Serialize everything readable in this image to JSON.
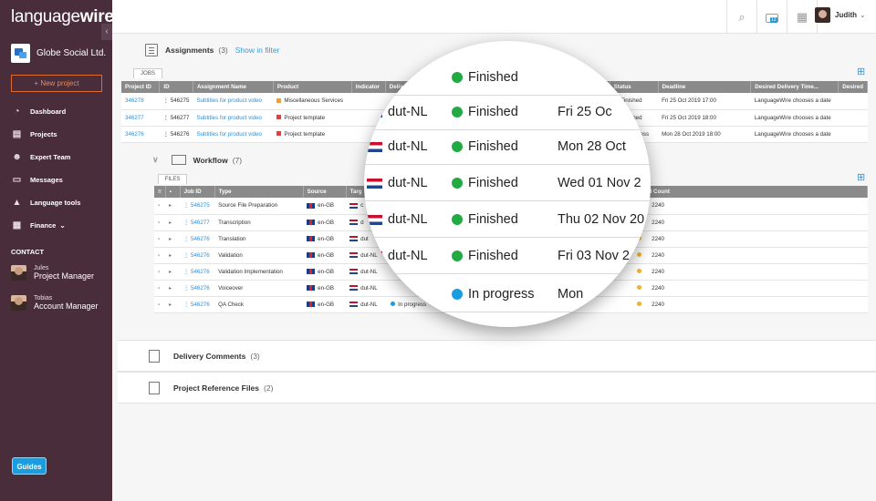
{
  "app": {
    "logo_a": "language",
    "logo_b": "wire"
  },
  "sidebar": {
    "company": "Globe Social Ltd.",
    "new_project": "+ New project",
    "items": [
      {
        "label": "Dashboard",
        "icon": "speedometer-icon"
      },
      {
        "label": "Projects",
        "icon": "folders-icon"
      },
      {
        "label": "Expert Team",
        "icon": "team-icon"
      },
      {
        "label": "Messages",
        "icon": "chat-icon"
      },
      {
        "label": "Language tools",
        "icon": "tools-icon"
      },
      {
        "label": "Finance",
        "icon": "finance-icon"
      }
    ],
    "contact_heading": "CONTACT",
    "contacts": [
      {
        "name": "Jules",
        "role": "Project Manager"
      },
      {
        "name": "Tobias",
        "role": "Account Manager"
      }
    ],
    "guides": "Guides"
  },
  "topbar": {
    "user": "Judith",
    "badge": "12"
  },
  "assignments": {
    "title": "Assignments",
    "count": "(3)",
    "link": "Show in filter",
    "tab": "JOBS",
    "columns": [
      "Project ID",
      "ID",
      "Assignment Name",
      "Product",
      "Indicator",
      "Delive",
      "",
      "",
      "Status",
      "Deadline",
      "Desired Delivery Time...",
      "Desired"
    ],
    "rows": [
      {
        "pid": "346278",
        "id": "546275",
        "name": "Subtitles for product video",
        "product": "Miscellaneous Services",
        "product_color": "#f0a030",
        "status": "Finished",
        "status_color": "#22aa44",
        "deadline": "Fri 25 Oct 2019 17:00",
        "desired": "LanguageWire chooses a date"
      },
      {
        "pid": "346277",
        "id": "546277",
        "name": "Subtitles for product video",
        "product": "Project template",
        "product_color": "#e04040",
        "status": "Finished",
        "status_color": "#22aa44",
        "deadline": "Fri 25 Oct 2019 18:00",
        "desired": "LanguageWire chooses a date"
      },
      {
        "pid": "346276",
        "id": "546276",
        "name": "Subtitles for product video",
        "product": "Project template",
        "product_color": "#e04040",
        "status": "In progress",
        "status_color": "#1a9de0",
        "deadline": "Mon 28 Oct 2019 18:00",
        "desired": "LanguageWire chooses a date"
      }
    ]
  },
  "workflow": {
    "title": "Workflow",
    "count": "(7)",
    "tab": "FILES",
    "columns": [
      "",
      "",
      "Job ID",
      "Type",
      "Source",
      "Targ",
      "",
      "",
      "",
      "",
      "Word Count"
    ],
    "rows": [
      {
        "jid": "546275",
        "type": "Source File Preparation",
        "src": "en-GB",
        "tgt": "c",
        "mid": "",
        "wc": "2240"
      },
      {
        "jid": "546277",
        "type": "Transcription",
        "src": "en-GB",
        "tgt": "d",
        "mid": "",
        "wc": "2240"
      },
      {
        "jid": "546276",
        "type": "Translation",
        "src": "en-GB",
        "tgt": "dut",
        "mid": "",
        "wc": "2240"
      },
      {
        "jid": "546276",
        "type": "Validation",
        "src": "en-GB",
        "tgt": "dut-NL",
        "mid": "",
        "wc": "2240"
      },
      {
        "jid": "546276",
        "type": "Validation Implementation",
        "src": "en-GB",
        "tgt": "dut-NL",
        "mid": "erred",
        "wc": "2240"
      },
      {
        "jid": "546276",
        "type": "Voiceover",
        "src": "en-GB",
        "tgt": "dut-NL",
        "mid": "ive relation",
        "wc": "2240"
      },
      {
        "jid": "546276",
        "type": "QA Check",
        "src": "en-GB",
        "tgt": "dut-NL",
        "status": "In progress",
        "mid": "No active relation",
        "wc": "2240"
      }
    ]
  },
  "delivery_comments": {
    "title": "Delivery Comments",
    "count": "(3)"
  },
  "reference_files": {
    "title": "Project Reference Files",
    "count": "(2)"
  },
  "magnifier": {
    "rows": [
      {
        "lang": "",
        "status": "Finished",
        "color": "#22aa44",
        "date": ""
      },
      {
        "lang": "dut-NL",
        "status": "Finished",
        "color": "#22aa44",
        "date": "Fri 25 Oc"
      },
      {
        "lang": "dut-NL",
        "status": "Finished",
        "color": "#22aa44",
        "date": "Mon 28 Oct"
      },
      {
        "lang": "dut-NL",
        "status": "Finished",
        "color": "#22aa44",
        "date": "Wed 01 Nov 2"
      },
      {
        "lang": "dut-NL",
        "status": "Finished",
        "color": "#22aa44",
        "date": "Thu 02 Nov 20"
      },
      {
        "lang": "dut-NL",
        "status": "Finished",
        "color": "#22aa44",
        "date": "Fri 03 Nov 2"
      },
      {
        "lang": "NL",
        "status": "In progress",
        "color": "#1a9de0",
        "date": "Mon"
      }
    ]
  }
}
